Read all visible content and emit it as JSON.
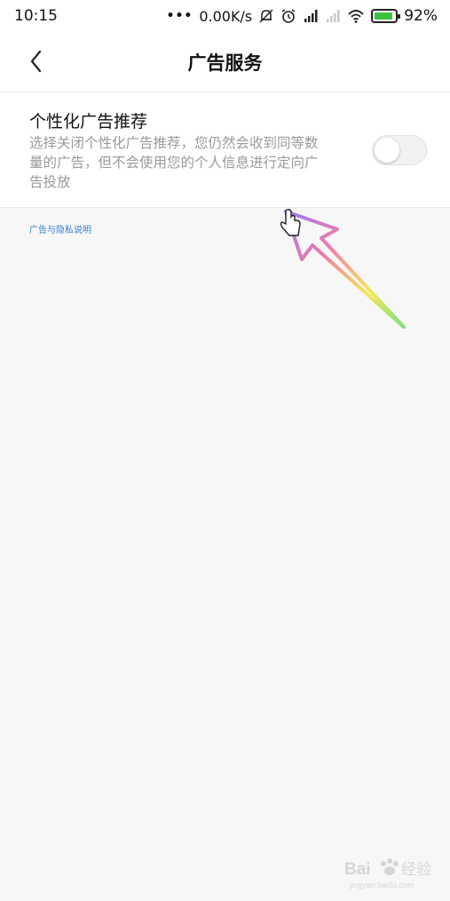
{
  "status_bar": {
    "time": "10:15",
    "dots": "•••",
    "net_speed": "0.00K/s",
    "battery_percent": "92%",
    "battery_level": 0.92,
    "icons": [
      "mute-bell-icon",
      "alarm-clock-icon",
      "signal-icon",
      "signal-weak-icon",
      "wifi-icon",
      "battery-charging-icon"
    ]
  },
  "header": {
    "title": "广告服务",
    "back_icon": "chevron-left-icon"
  },
  "setting": {
    "title": "个性化广告推荐",
    "description": "选择关闭个性化广告推荐，您仍然会收到同等数量的广告，但不会使用您的个人信息进行定向广告投放",
    "toggle_state": "off"
  },
  "privacy_link": "广告与隐私说明",
  "watermark": {
    "text": "Bai 经验",
    "url": "jingyan.baidu.com"
  },
  "colors": {
    "background": "#f7f7f7",
    "link": "#3a82c8",
    "battery": "#3cc43c"
  }
}
